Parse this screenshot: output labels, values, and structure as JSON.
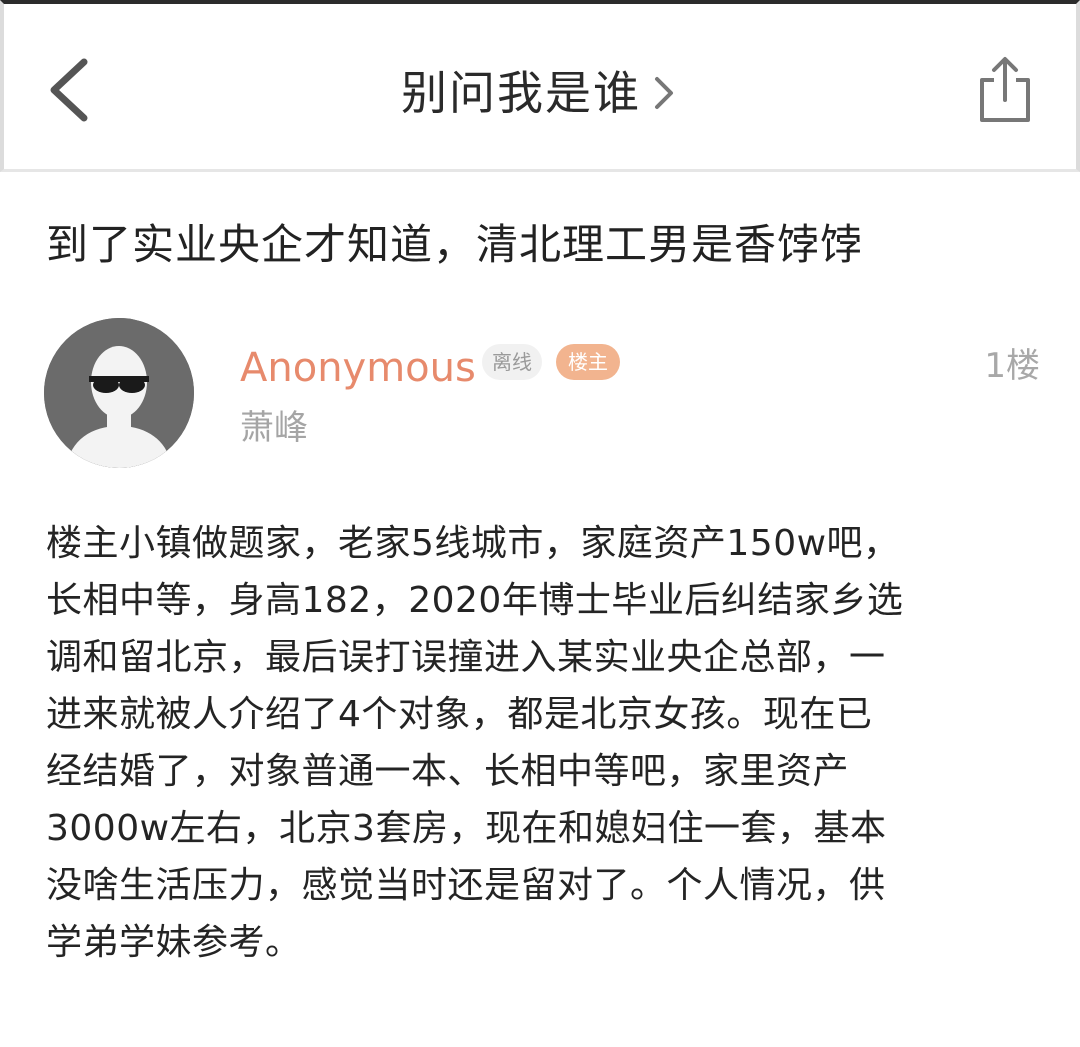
{
  "header": {
    "title": "别问我是谁",
    "back_icon": "chevron-left-icon",
    "title_icon": "chevron-right-icon",
    "share_icon": "share-icon"
  },
  "post": {
    "title": "到了实业央企才知道，清北理工男是香饽饽",
    "author": {
      "name": "Anonymous",
      "status_badge": "离线",
      "op_badge": "楼主",
      "subtitle": "萧峰",
      "avatar_icon": "anonymous-avatar-icon"
    },
    "floor": "1楼",
    "body_lines": [
      "楼主小镇做题家，老家5线城市，家庭资产150w吧，",
      "长相中等，身高182，2020年博士毕业后纠结家乡选",
      "调和留北京，最后误打误撞进入某实业央企总部，一",
      "进来就被人介绍了4个对象，都是北京女孩。现在已",
      "经结婚了，对象普通一本、长相中等吧，家里资产",
      "3000w左右，北京3套房，现在和媳妇住一套，基本",
      "没啥生活压力，感觉当时还是留对了。个人情况，供",
      "学弟学妹参考。"
    ]
  },
  "colors": {
    "author_name": "#e78a6c",
    "op_badge_bg": "#f2b48f",
    "muted_text": "#a5a5a5"
  }
}
